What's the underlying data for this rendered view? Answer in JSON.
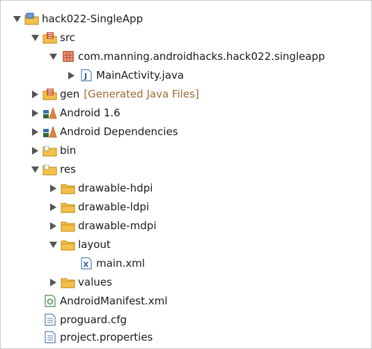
{
  "tree": {
    "project": {
      "label": "hack022-SingleApp",
      "icon": "project-folder-icon"
    },
    "src": {
      "label": "src",
      "icon": "source-folder-icon"
    },
    "package": {
      "label": "com.manning.androidhacks.hack022.singleapp",
      "icon": "package-icon"
    },
    "main_activity": {
      "label": "MainActivity.java",
      "icon": "java-file-icon"
    },
    "gen": {
      "label": "gen",
      "sublabel": "[Generated Java Files]",
      "icon": "source-folder-icon"
    },
    "android_16": {
      "label": "Android 1.6",
      "icon": "library-icon"
    },
    "android_deps": {
      "label": "Android Dependencies",
      "icon": "library-icon"
    },
    "bin": {
      "label": "bin",
      "icon": "folder-icon"
    },
    "res": {
      "label": "res",
      "icon": "folder-icon"
    },
    "drawable_hdpi": {
      "label": "drawable-hdpi",
      "icon": "folder-icon"
    },
    "drawable_ldpi": {
      "label": "drawable-ldpi",
      "icon": "folder-icon"
    },
    "drawable_mdpi": {
      "label": "drawable-mdpi",
      "icon": "folder-icon"
    },
    "layout": {
      "label": "layout",
      "icon": "folder-icon"
    },
    "main_xml": {
      "label": "main.xml",
      "icon": "xml-file-icon"
    },
    "values": {
      "label": "values",
      "icon": "folder-icon"
    },
    "manifest": {
      "label": "AndroidManifest.xml",
      "icon": "manifest-file-icon"
    },
    "proguard": {
      "label": "proguard.cfg",
      "icon": "text-file-icon"
    },
    "project_props": {
      "label": "project.properties",
      "icon": "text-file-icon"
    }
  },
  "colors": {
    "folder": "#f3c04a",
    "folder_stroke": "#b8860b",
    "package": "#c44b2b",
    "twisty": "#555555",
    "sublabel": "#a06a34"
  }
}
